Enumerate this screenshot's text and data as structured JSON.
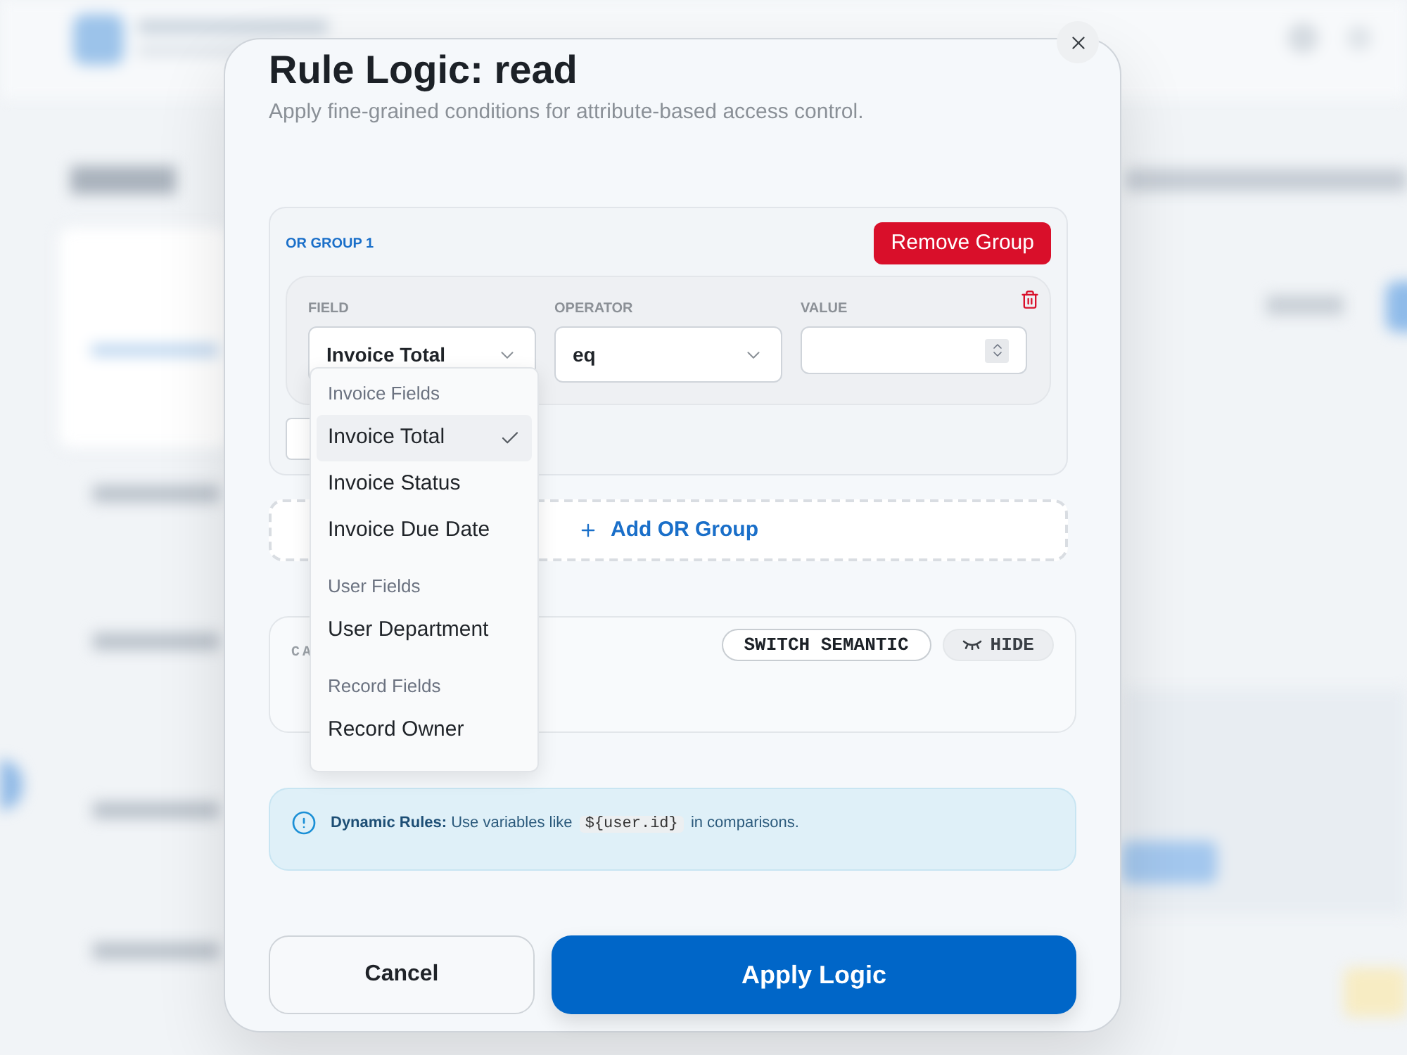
{
  "dialog": {
    "title": "Rule Logic: read",
    "subtitle": "Apply fine-grained conditions for attribute-based access control."
  },
  "groups": [
    {
      "label": "OR GROUP 1",
      "remove_button": "Remove Group",
      "conditions": [
        {
          "field": {
            "label": "FIELD",
            "value": "Invoice Total",
            "expanded": true,
            "menu": [
              {
                "heading": "Invoice Fields",
                "options": [
                  {
                    "label": "Invoice Total",
                    "selected": true
                  },
                  {
                    "label": "Invoice Status",
                    "selected": false
                  },
                  {
                    "label": "Invoice Due Date",
                    "selected": false
                  }
                ]
              },
              {
                "heading": "User Fields",
                "options": [
                  {
                    "label": "User Department",
                    "selected": false
                  }
                ]
              },
              {
                "heading": "Record Fields",
                "options": [
                  {
                    "label": "Record Owner",
                    "selected": false
                  }
                ]
              }
            ]
          },
          "operator": {
            "label": "OPERATOR",
            "value": "eq"
          },
          "value": {
            "label": "VALUE"
          }
        }
      ]
    }
  ],
  "add_group_button": "Add OR Group",
  "semantic_panel": {
    "label": "CA",
    "switch_button": "SWITCH SEMANTIC",
    "hide_button": "HIDE"
  },
  "info": {
    "label": "Dynamic Rules:",
    "text_before": "Use variables like",
    "code": "${user.id}",
    "text_after": "in comparisons."
  },
  "footer": {
    "cancel": "Cancel",
    "apply": "Apply Logic"
  }
}
